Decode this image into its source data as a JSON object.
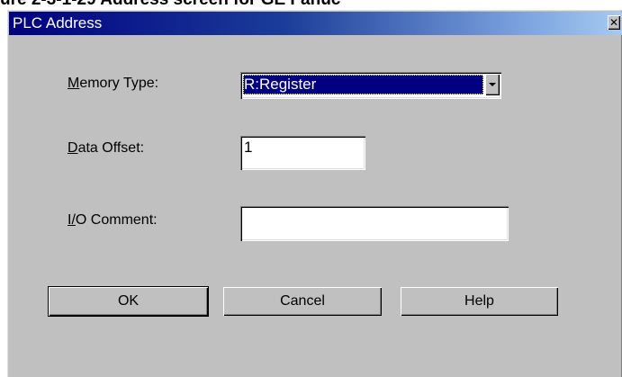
{
  "caption": "ure 2-3-1-29 Address screen for GE Fanuc",
  "window": {
    "title": "PLC Address",
    "close_glyph": "✕",
    "close_icon": "close-icon"
  },
  "form": {
    "memory_type_label": "Memory Type:",
    "memory_type_value": "R:Register",
    "memory_type_dropdown_icon": "chevron-down-icon",
    "data_offset_label": "Data Offset:",
    "data_offset_value": "1",
    "io_comment_label": "I/O Comment:",
    "io_comment_value": ""
  },
  "buttons": {
    "ok": "OK",
    "cancel": "Cancel",
    "help": "Help"
  },
  "colors": {
    "titlebar_start": "#000080",
    "titlebar_end": "#a6caf0",
    "dialog_face": "#c0c0c0",
    "selection": "#000080"
  }
}
